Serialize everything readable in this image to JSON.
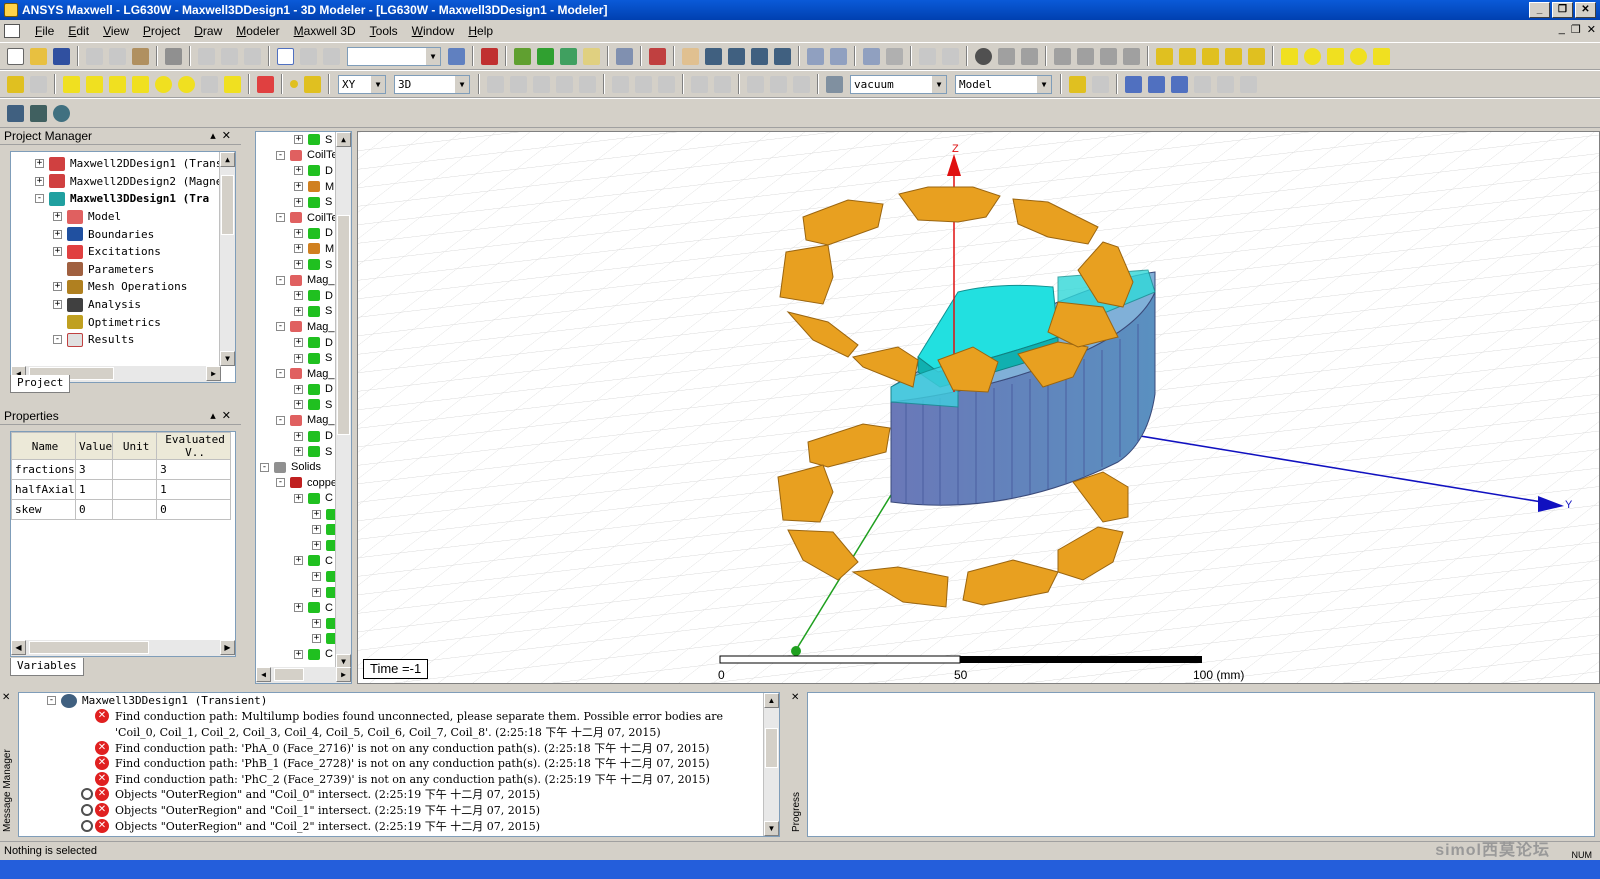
{
  "window": {
    "title": "ANSYS Maxwell - LG630W - Maxwell3DDesign1 - 3D Modeler - [LG630W - Maxwell3DDesign1 - Modeler]"
  },
  "menu": [
    "File",
    "Edit",
    "View",
    "Project",
    "Draw",
    "Modeler",
    "Maxwell 3D",
    "Tools",
    "Window",
    "Help"
  ],
  "toolbar": {
    "plane_select": "XY",
    "dim_select": "3D",
    "material_select": "vacuum",
    "mode_select": "Model"
  },
  "project_manager": {
    "title": "Project Manager",
    "items": [
      {
        "label": "Maxwell2DDesign1 (Transie",
        "level": 1,
        "expand": "+",
        "bold": false
      },
      {
        "label": "Maxwell2DDesign2 (Magnet",
        "level": 1,
        "expand": "+",
        "bold": false
      },
      {
        "label": "Maxwell3DDesign1 (Tra",
        "level": 1,
        "expand": "-",
        "bold": true
      },
      {
        "label": "Model",
        "level": 2,
        "expand": "+",
        "bold": false
      },
      {
        "label": "Boundaries",
        "level": 2,
        "expand": "+",
        "bold": false
      },
      {
        "label": "Excitations",
        "level": 2,
        "expand": "+",
        "bold": false
      },
      {
        "label": "Parameters",
        "level": 2,
        "expand": "",
        "bold": false
      },
      {
        "label": "Mesh Operations",
        "level": 2,
        "expand": "+",
        "bold": false
      },
      {
        "label": "Analysis",
        "level": 2,
        "expand": "+",
        "bold": false
      },
      {
        "label": "Optimetrics",
        "level": 2,
        "expand": "",
        "bold": false
      },
      {
        "label": "Results",
        "level": 2,
        "expand": "-",
        "bold": false
      }
    ],
    "tab": "Project"
  },
  "properties": {
    "title": "Properties",
    "columns": [
      "Name",
      "Value",
      "Unit",
      "Evaluated V.."
    ],
    "rows": [
      [
        "fractions",
        "3",
        "",
        "3"
      ],
      [
        "halfAxial",
        "1",
        "",
        "1"
      ],
      [
        "skew",
        "0",
        "",
        "0"
      ]
    ],
    "tab": "Variables"
  },
  "model_tree": {
    "items": [
      {
        "label": "S",
        "level": 2
      },
      {
        "label": "CoilTe",
        "level": 1
      },
      {
        "label": "D",
        "level": 2
      },
      {
        "label": "M",
        "level": 2
      },
      {
        "label": "S",
        "level": 2
      },
      {
        "label": "CoilTe",
        "level": 1
      },
      {
        "label": "D",
        "level": 2
      },
      {
        "label": "M",
        "level": 2
      },
      {
        "label": "S",
        "level": 2
      },
      {
        "label": "Mag_",
        "level": 1
      },
      {
        "label": "D",
        "level": 2
      },
      {
        "label": "S",
        "level": 2
      },
      {
        "label": "Mag_",
        "level": 1
      },
      {
        "label": "D",
        "level": 2
      },
      {
        "label": "S",
        "level": 2
      },
      {
        "label": "Mag_",
        "level": 1
      },
      {
        "label": "D",
        "level": 2
      },
      {
        "label": "S",
        "level": 2
      },
      {
        "label": "Mag_",
        "level": 1
      },
      {
        "label": "D",
        "level": 2
      },
      {
        "label": "S",
        "level": 2
      },
      {
        "label": "Solids",
        "level": 0
      },
      {
        "label": "coppe",
        "level": 1
      },
      {
        "label": "C",
        "level": 2
      },
      {
        "label": "",
        "level": 3
      },
      {
        "label": "",
        "level": 3
      },
      {
        "label": "",
        "level": 3
      },
      {
        "label": "C",
        "level": 2
      },
      {
        "label": "",
        "level": 3
      },
      {
        "label": "",
        "level": 3
      },
      {
        "label": "C",
        "level": 2
      },
      {
        "label": "",
        "level": 3
      },
      {
        "label": "",
        "level": 3
      },
      {
        "label": "C",
        "level": 2
      }
    ]
  },
  "viewport": {
    "axis_z": "Z",
    "axis_y": "Y",
    "time_label": "Time =-1",
    "scale_labels": [
      "0",
      "50",
      "100 (mm)"
    ]
  },
  "messages": {
    "header": "Maxwell3DDesign1 (Transient)",
    "lines": [
      {
        "icon": "error",
        "text": "Find conduction path: Multilump bodies found unconnected, please separate them. Possible error bodies are"
      },
      {
        "icon": "",
        "text": "'Coil_0, Coil_1, Coil_2, Coil_3, Coil_4, Coil_5, Coil_6, Coil_7, Coil_8'.  (2:25:18 下午  十二月 07, 2015)"
      },
      {
        "icon": "error",
        "text": "Find conduction path: 'PhA_0 (Face_2716)' is not on any conduction path(s).  (2:25:18 下午  十二月 07, 2015)"
      },
      {
        "icon": "error",
        "text": "Find conduction path: 'PhB_1 (Face_2728)' is not on any conduction path(s).  (2:25:18 下午  十二月 07, 2015)"
      },
      {
        "icon": "error",
        "text": "Find conduction path: 'PhC_2 (Face_2739)' is not on any conduction path(s).  (2:25:19 下午  十二月 07, 2015)"
      },
      {
        "icon": "error2",
        "text": "Objects \"OuterRegion\" and \"Coil_0\" intersect.  (2:25:19 下午  十二月 07, 2015)"
      },
      {
        "icon": "error2",
        "text": "Objects \"OuterRegion\" and \"Coil_1\" intersect.  (2:25:19 下午  十二月 07, 2015)"
      },
      {
        "icon": "error2",
        "text": "Objects \"OuterRegion\" and \"Coil_2\" intersect.  (2:25:19 下午  十二月 07, 2015)"
      }
    ],
    "side_label": "Message Manager"
  },
  "progress": {
    "side_label": "Progress"
  },
  "status": {
    "text": "Nothing is selected",
    "num": "NUM",
    "watermark": "simol西莫论坛"
  },
  "colors": {
    "coil": "#e8a020",
    "rotor": "#20d8d8",
    "stator": "#6a8ac0",
    "axis_x": "#1fa01f",
    "axis_y": "#1010c0",
    "axis_z": "#e01010"
  }
}
